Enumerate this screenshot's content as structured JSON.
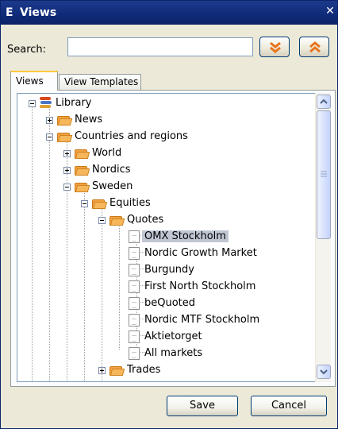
{
  "window": {
    "title_icon": "E",
    "title": "Views",
    "close_glyph": "✕"
  },
  "search": {
    "label": "Search:",
    "value": "",
    "placeholder": ""
  },
  "toolbar": {
    "expand_all_icon": "double-chevron-down-icon",
    "collapse_all_icon": "double-chevron-up-icon",
    "accent": "#e8741c"
  },
  "tabs": [
    {
      "label": "Views",
      "active": true
    },
    {
      "label": "View Templates",
      "active": false
    }
  ],
  "tree": {
    "library": "Library",
    "news": "News",
    "countries": "Countries and regions",
    "world": "World",
    "nordics": "Nordics",
    "sweden": "Sweden",
    "equities": "Equities",
    "quotes": "Quotes",
    "items": [
      "OMX Stockholm",
      "Nordic Growth Market",
      "Burgundy",
      "First North Stockholm",
      "beQuoted",
      "Nordic MTF Stockholm",
      "Aktietorget",
      "All markets"
    ],
    "selected_item": "OMX Stockholm",
    "trades": "Trades"
  },
  "buttons": {
    "save": "Save",
    "cancel": "Cancel"
  }
}
